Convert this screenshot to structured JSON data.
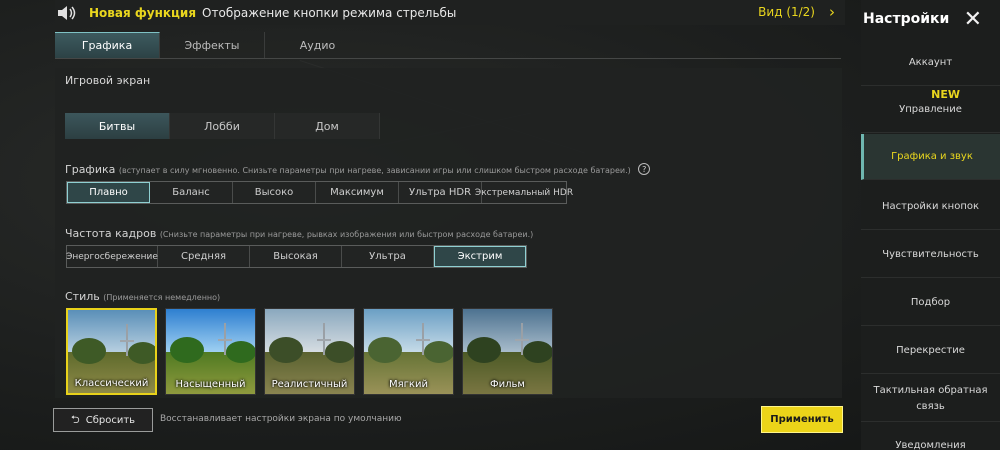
{
  "banner": {
    "new_label": "Новая функция",
    "text": "Отображение кнопки режима стрельбы",
    "view": "Вид (1/2)",
    "speaker_icon": "speaker-icon",
    "chevron_icon": "chevron-right-icon"
  },
  "tabs": [
    {
      "label": "Графика",
      "active": true
    },
    {
      "label": "Эффекты",
      "active": false
    },
    {
      "label": "Аудио",
      "active": false
    }
  ],
  "section": {
    "title": "Игровой экран",
    "mode_tabs": [
      {
        "label": "Битвы",
        "active": true
      },
      {
        "label": "Лобби",
        "active": false
      },
      {
        "label": "Дом",
        "active": false
      }
    ]
  },
  "graphics": {
    "label": "Графика",
    "note": "(вступает в силу мгновенно. Снизьте параметры при нагреве, зависании игры или слишком быстром расходе батареи.)",
    "help": "?",
    "options": [
      "Плавно",
      "Баланс",
      "Высоко",
      "Максимум",
      "Ультра HDR",
      "Экстремальный HDR"
    ],
    "selected": "Плавно"
  },
  "framerate": {
    "label": "Частота кадров",
    "note": "(Снизьте параметры при нагреве, рывках изображения или быстром расходе батареи.)",
    "options": [
      "Энергосбережение",
      "Средняя",
      "Высокая",
      "Ультра",
      "Экстрим"
    ],
    "selected": "Экстрим"
  },
  "style": {
    "label": "Стиль",
    "note": "(Применяется немедленно)",
    "options": [
      "Классический",
      "Насыщенный",
      "Реалистичный",
      "Мягкий",
      "Фильм"
    ],
    "selected": "Классический"
  },
  "footer": {
    "reset_label": "Сбросить",
    "reset_icon": "undo-arrow-icon",
    "hint": "Восстанавливает настройки экрана по умолчанию",
    "apply_label": "Применить"
  },
  "sidebar": {
    "title": "Настройки",
    "close_icon": "close-icon",
    "new_badge": "NEW",
    "items": [
      {
        "label": "Аккаунт",
        "active": false
      },
      {
        "label": "Управление",
        "active": false
      },
      {
        "label": "Графика и звук",
        "active": true
      },
      {
        "label": "Настройки кнопок",
        "active": false
      },
      {
        "label": "Чувствительность",
        "active": false
      },
      {
        "label": "Подбор",
        "active": false
      },
      {
        "label": "Перекрестие",
        "active": false
      },
      {
        "label": "Тактильная обратная связь",
        "active": false
      },
      {
        "label": "Уведомления",
        "active": false
      }
    ]
  },
  "colors": {
    "accent_yellow": "#e9d61e",
    "accent_teal": "#8fd0d2",
    "panel_bg": "#202221"
  }
}
